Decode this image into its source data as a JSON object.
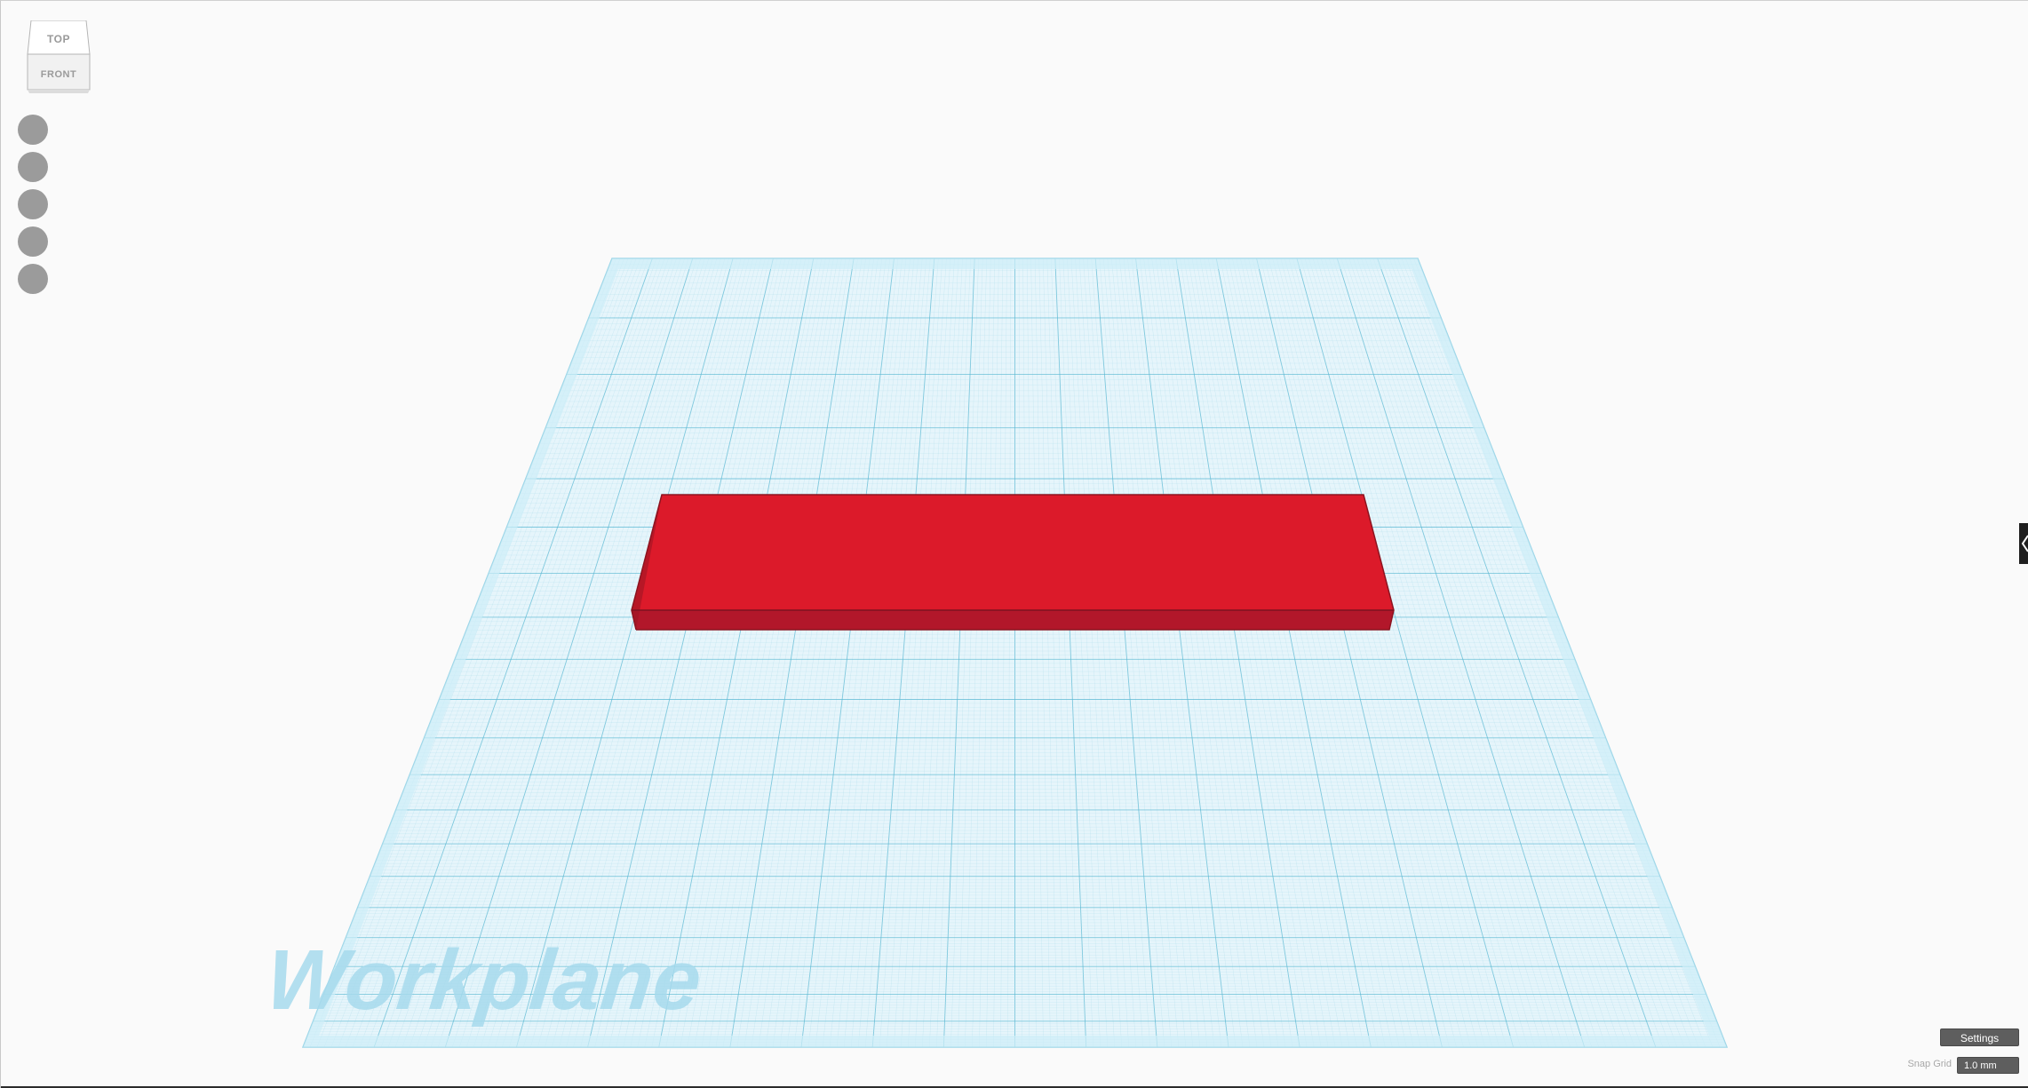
{
  "viewcube": {
    "top_label": "TOP",
    "front_label": "FRONT"
  },
  "nav_tools": [
    {
      "icon": "home-view-icon"
    },
    {
      "icon": "fit-all-icon"
    },
    {
      "icon": "zoom-in-icon"
    },
    {
      "icon": "zoom-out-icon"
    },
    {
      "icon": "perspective-icon"
    }
  ],
  "workplane": {
    "label": "Workplane",
    "colors": {
      "fill": "#e6f5fb",
      "grid_minor": "#a9dbeb",
      "grid_major": "#5bb8d3",
      "border": "#bfe6f3",
      "label": "#a6d9ec"
    }
  },
  "shape": {
    "name": "box",
    "color": "#dc1a2a"
  },
  "controls": {
    "settings_label": "Settings",
    "snap_grid_label": "Snap Grid",
    "snap_grid_value": "1.0 mm"
  }
}
